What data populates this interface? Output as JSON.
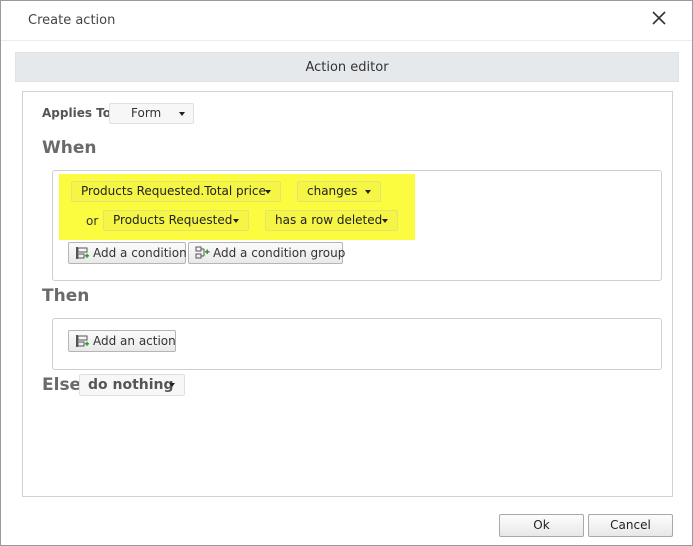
{
  "dialog": {
    "title": "Create action",
    "close_icon": "close-icon"
  },
  "editor": {
    "header": "Action editor"
  },
  "applies_to": {
    "label": "Applies To",
    "value": "Form"
  },
  "when": {
    "heading": "When",
    "conditions": [
      {
        "connector": "",
        "field": "Products Requested.Total price",
        "operator": "changes"
      },
      {
        "connector": "or",
        "field": "Products Requested",
        "operator": "has a row deleted"
      }
    ],
    "add_condition_label": "Add a condition",
    "add_condition_group_label": "Add a condition group",
    "highlight_color": "#fbfb3f"
  },
  "then": {
    "heading": "Then",
    "add_action_label": "Add an action"
  },
  "else": {
    "heading": "Else",
    "value": "do nothing"
  },
  "footer": {
    "ok_label": "Ok",
    "cancel_label": "Cancel"
  }
}
